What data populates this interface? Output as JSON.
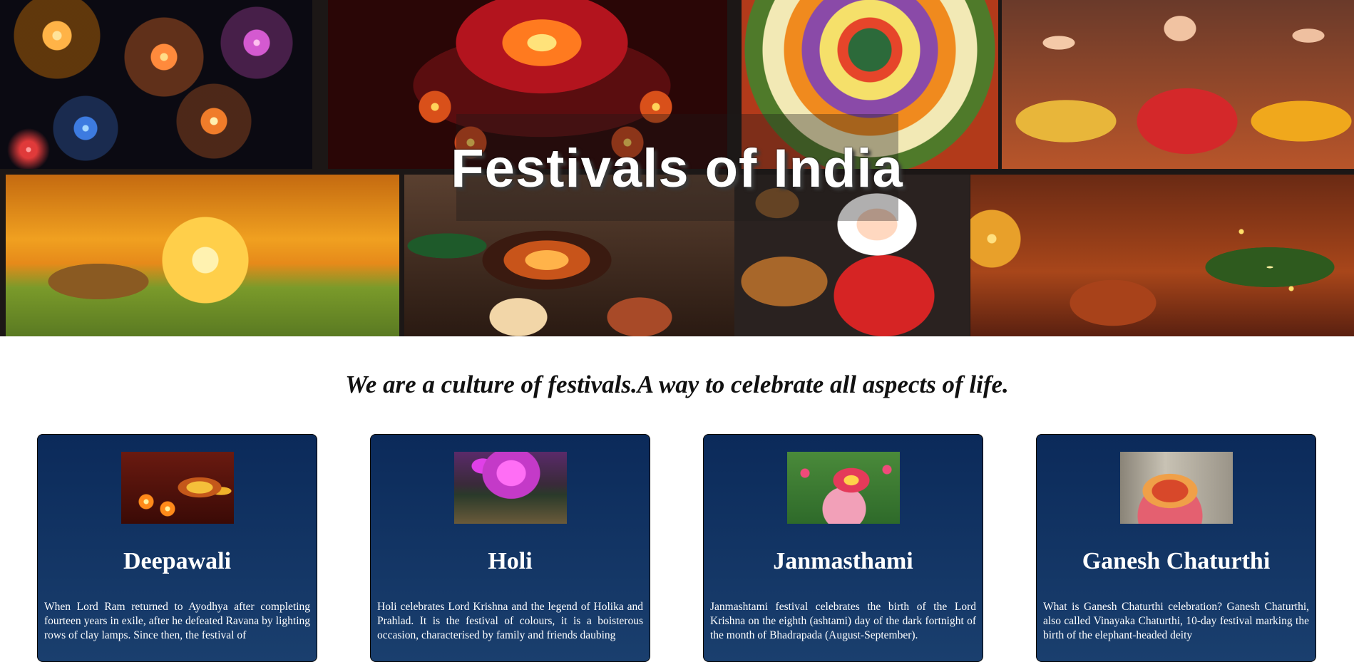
{
  "hero": {
    "title": "Festivals of India"
  },
  "tagline": "We are a culture of festivals.A way to celebrate all aspects of life.",
  "cards": [
    {
      "title": "Deepawali",
      "text": "When Lord Ram returned to Ayodhya after completing fourteen years in exile, after he defeated Ravana by lighting rows of clay lamps. Since then, the festival of"
    },
    {
      "title": "Holi",
      "text": "Holi celebrates Lord Krishna and the legend of Holika and Prahlad. It is the festival of colours, it is a boisterous occasion, characterised by family and friends daubing"
    },
    {
      "title": "Janmasthami",
      "text": "Janmashtami festival celebrates the birth of the Lord Krishna on the eighth (ashtami) day of the dark fortnight of the month of Bhadrapada (August-September)."
    },
    {
      "title": "Ganesh Chaturthi",
      "text": "What is Ganesh Chaturthi celebration? Ganesh Chaturthi, also called Vinayaka Chaturthi, 10-day festival marking the birth of the elephant-headed deity"
    }
  ]
}
